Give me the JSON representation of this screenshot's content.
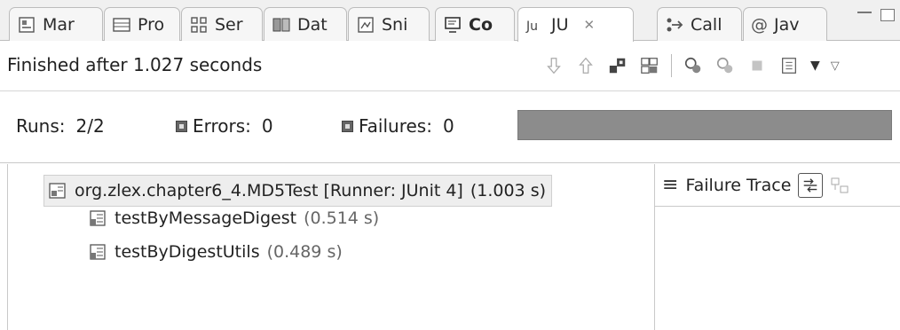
{
  "tabs": [
    {
      "label": "Mar",
      "icon": "markers-icon"
    },
    {
      "label": "Pro",
      "icon": "properties-icon"
    },
    {
      "label": "Ser",
      "icon": "servers-icon"
    },
    {
      "label": "Dat",
      "icon": "data-source-icon"
    },
    {
      "label": "Sni",
      "icon": "snippets-icon"
    },
    {
      "label": "Co",
      "icon": "console-icon"
    },
    {
      "label": "JU",
      "icon": "junit-icon",
      "active": true,
      "close": "✕"
    },
    {
      "label": "Call",
      "icon": "call-hierarchy-icon"
    },
    {
      "label": "Jav",
      "icon": "javadoc-icon",
      "prefix": "@"
    }
  ],
  "toolbar": {
    "status": "Finished after 1.027 seconds",
    "icons": [
      "next-failure-icon",
      "previous-failure-icon",
      "show-failures-only-icon",
      "scroll-lock-icon",
      "rerun-test-icon",
      "rerun-failed-first-icon",
      "stop-icon",
      "test-history-icon",
      "view-menu-icon"
    ]
  },
  "counters": {
    "runs_label": "Runs:",
    "runs_value": "2/2",
    "errors_label": "Errors:",
    "errors_value": "0",
    "failures_label": "Failures:",
    "failures_value": "0",
    "progress": 1.0
  },
  "tree": {
    "root": {
      "label": "org.zlex.chapter6_4.MD5Test [Runner: JUnit 4]",
      "time": "(1.003 s)"
    },
    "tests": [
      {
        "label": "testByMessageDigest",
        "time": "(0.514 s)"
      },
      {
        "label": "testByDigestUtils",
        "time": "(0.489 s)"
      }
    ]
  },
  "trace": {
    "title": "Failure Trace"
  },
  "colors": {
    "progress_bar": "#8a8a8a",
    "selection_bg": "#eeeeee"
  }
}
